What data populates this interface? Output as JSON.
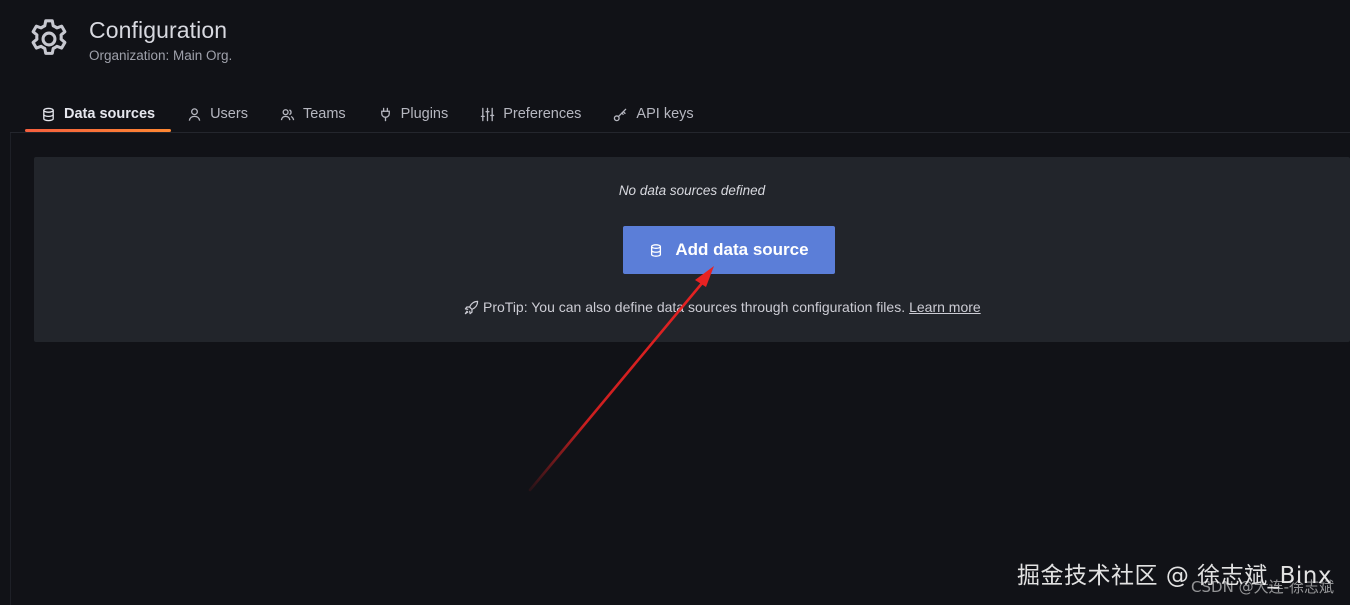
{
  "header": {
    "icon": "gear-icon",
    "title": "Configuration",
    "subtitle": "Organization: Main Org."
  },
  "tabs": [
    {
      "label": "Data sources",
      "icon": "database-icon",
      "active": true
    },
    {
      "label": "Users",
      "icon": "user-icon",
      "active": false
    },
    {
      "label": "Teams",
      "icon": "users-icon",
      "active": false
    },
    {
      "label": "Plugins",
      "icon": "plug-icon",
      "active": false
    },
    {
      "label": "Preferences",
      "icon": "sliders-icon",
      "active": false
    },
    {
      "label": "API keys",
      "icon": "key-icon",
      "active": false
    }
  ],
  "empty_state": {
    "message": "No data sources defined",
    "button_label": "Add data source",
    "button_icon": "database-icon",
    "protip_icon": "rocket-icon",
    "protip_text": "ProTip: You can also define data sources through configuration files.",
    "learn_more": "Learn more"
  },
  "watermark": {
    "main": "掘金技术社区 @ 徐志斌_Binx",
    "sub": "CSDN @大连-徐志斌"
  },
  "colors": {
    "background": "#111217",
    "panel": "#22252b",
    "primary_button": "#5b7ed8",
    "active_tab_underline": "#f55f3e",
    "annotation_arrow": "#e02020"
  }
}
